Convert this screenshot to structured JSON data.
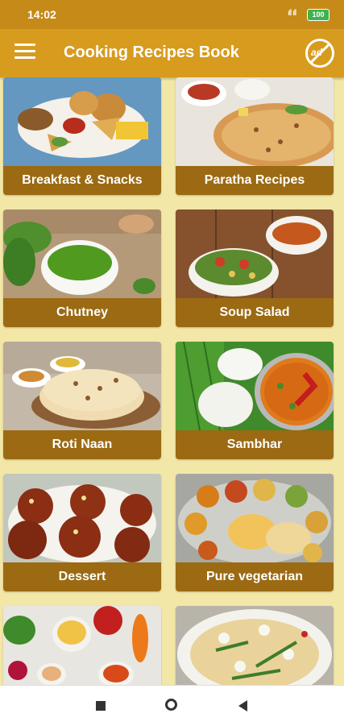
{
  "status_bar": {
    "time": "14:02",
    "signal": "ıll ıll",
    "battery": "100"
  },
  "app_bar": {
    "title": "Cooking Recipes Book",
    "no_ads_icon": "no-ads-icon",
    "menu_icon": "hamburger-menu-icon"
  },
  "categories": [
    {
      "label": "Breakfast & Snacks"
    },
    {
      "label": "Paratha Recipes"
    },
    {
      "label": "Chutney"
    },
    {
      "label": "Soup Salad"
    },
    {
      "label": "Roti Naan"
    },
    {
      "label": "Sambhar"
    },
    {
      "label": "Dessert"
    },
    {
      "label": "Pure vegetarian"
    },
    {
      "label": ""
    },
    {
      "label": ""
    }
  ],
  "colors": {
    "status_bar": "#c68a18",
    "app_bar": "#d79b1e",
    "label_bg": "#9b6a12",
    "background": "#f3e7a8"
  },
  "nav_bar": {
    "recent_icon": "square-icon",
    "home_icon": "circle-icon",
    "back_icon": "triangle-back-icon"
  }
}
